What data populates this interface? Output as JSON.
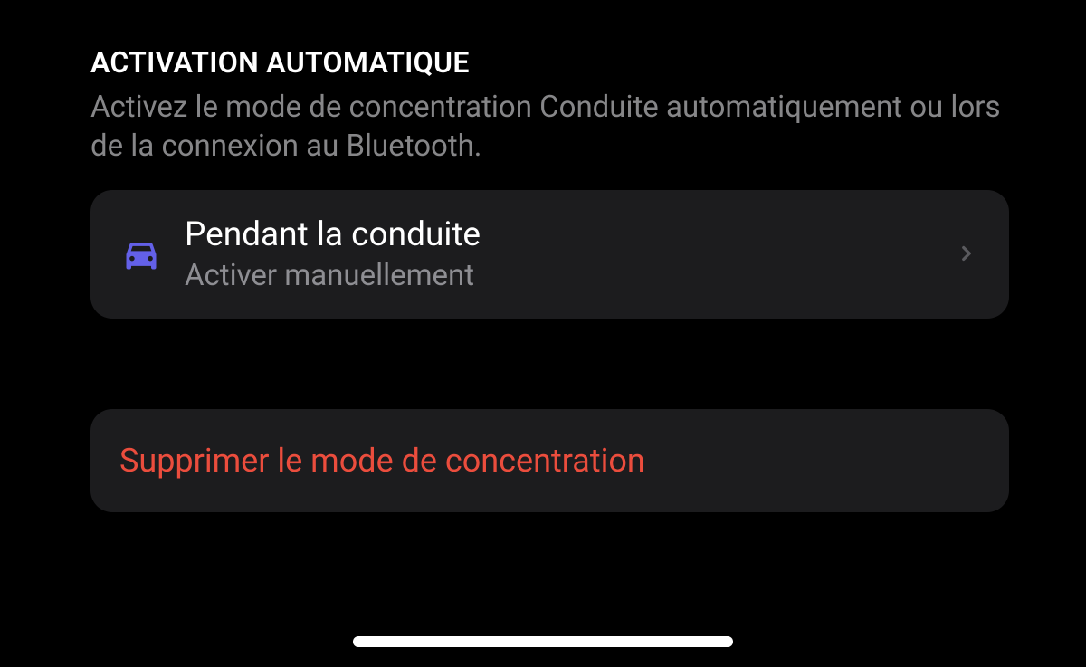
{
  "section": {
    "header": "ACTIVATION AUTOMATIQUE",
    "description": "Activez le mode de concentration Conduite automatiquement ou lors de la connexion au Bluetooth."
  },
  "drivingItem": {
    "title": "Pendant la conduite",
    "subtitle": "Activer manuellement",
    "iconColor": "#6360E8"
  },
  "deleteItem": {
    "label": "Supprimer le mode de concentration"
  }
}
